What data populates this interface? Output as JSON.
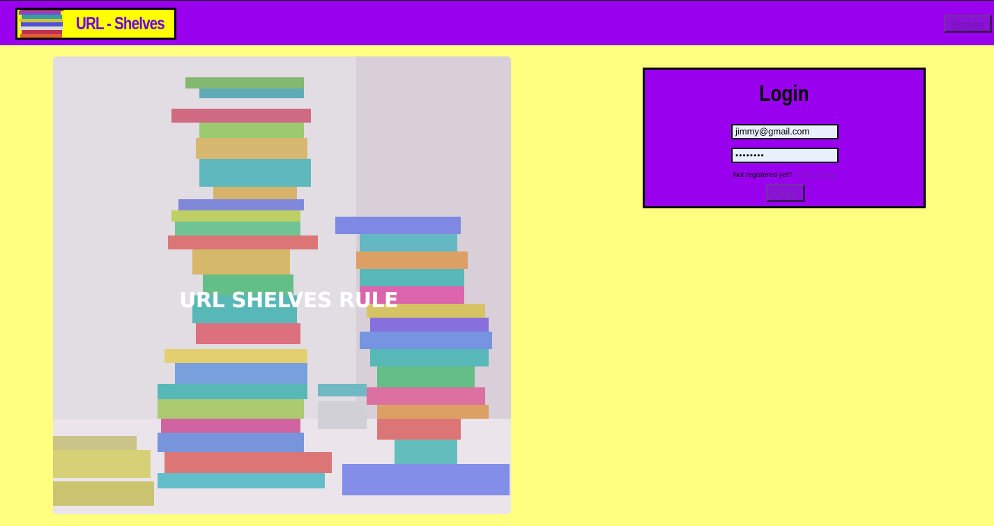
{
  "navbar": {
    "logo_text": "URL - Shelves",
    "register_label": "Register"
  },
  "hero": {
    "overlay_text": "URL SHELVES RULE"
  },
  "login": {
    "title": "Login",
    "email_value": "jimmy@gmail.com",
    "password_value": "••••••••",
    "not_registered_text": "Not registered yet?",
    "click_here_label": "Click Here",
    "submit_label": "Login"
  },
  "colors": {
    "background": "#ffff80",
    "navbar": "#9900ee",
    "logo_background": "#ffff00",
    "login_box": "#9900ee"
  }
}
